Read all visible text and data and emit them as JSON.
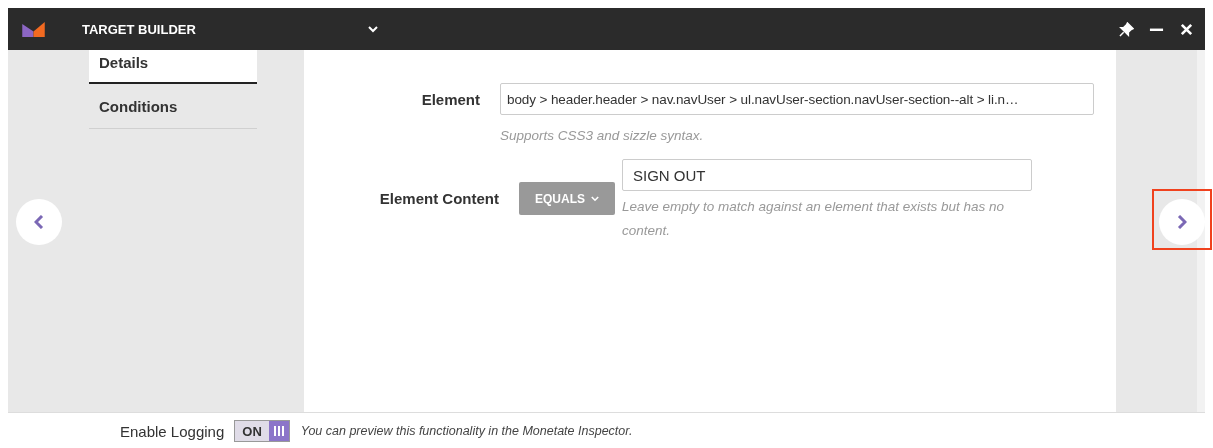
{
  "window": {
    "title": "TARGET BUILDER"
  },
  "tabs": [
    {
      "label": "Details",
      "selected": true
    },
    {
      "label": "Conditions",
      "selected": false
    }
  ],
  "form": {
    "element": {
      "label": "Element",
      "value": "body > header.header > nav.navUser > ul.navUser-section.navUser-section--alt > li.n…",
      "hint": "Supports CSS3 and sizzle syntax."
    },
    "element_content": {
      "label": "Element Content",
      "operator": "EQUALS",
      "value": "SIGN OUT",
      "hint": "Leave empty to match against an element that exists but has no content."
    }
  },
  "next_button": {
    "highlighted": true
  },
  "footer": {
    "label": "Enable Logging",
    "toggle": {
      "on": true,
      "label": "ON"
    },
    "note": "You can preview this functionality in the Monetate Inspector."
  }
}
